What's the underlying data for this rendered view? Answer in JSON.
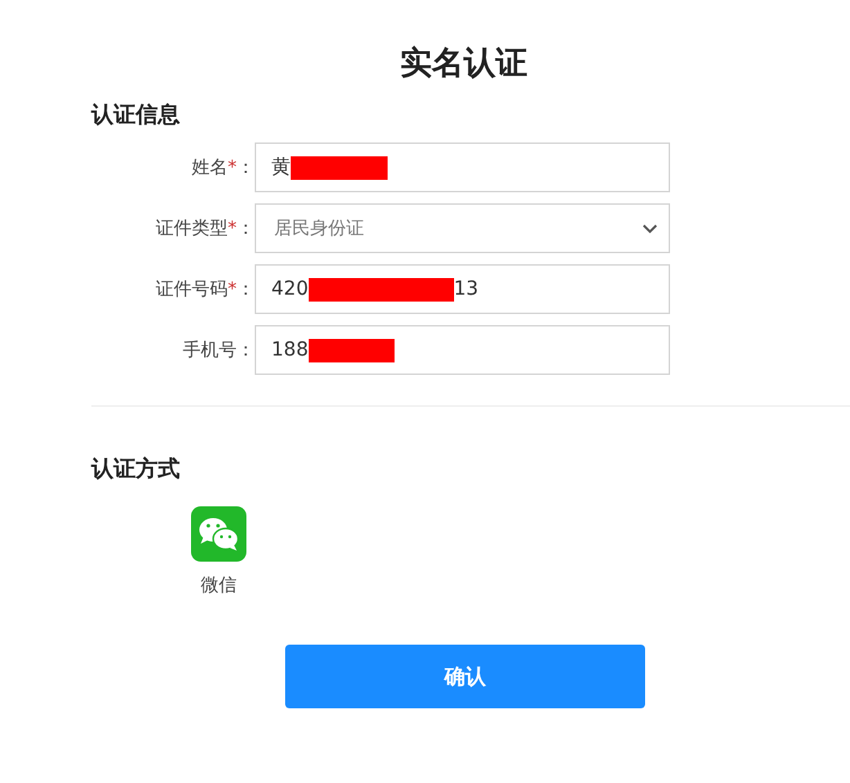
{
  "title": "实名认证",
  "info_section": {
    "heading": "认证信息",
    "fields": [
      {
        "kind": "input",
        "label": "姓名",
        "required_mark": "*",
        "colon": "：",
        "value_start": "黄",
        "redacted": true
      },
      {
        "kind": "select",
        "label": "证件类型",
        "required_mark": "*",
        "colon": "：",
        "value_start": "居民身份证",
        "redacted": false
      },
      {
        "kind": "input",
        "label": "证件号码",
        "required_mark": "*",
        "colon": "：",
        "value_start": "420",
        "redacted": true,
        "value_end": "13"
      },
      {
        "kind": "input",
        "label": "手机号",
        "colon": "：",
        "value_start": "188",
        "redacted": true
      }
    ]
  },
  "method_section": {
    "heading": "认证方式",
    "methods": [
      {
        "label": "微信"
      }
    ]
  },
  "confirm_button": "确认"
}
